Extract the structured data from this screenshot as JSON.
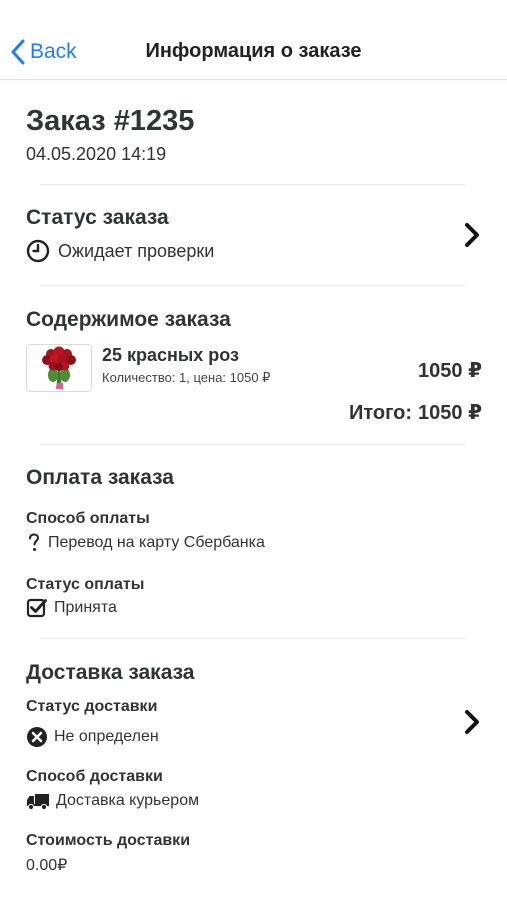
{
  "navbar": {
    "back_label": "Back",
    "title": "Информация о заказе"
  },
  "order": {
    "title": "Заказ #1235",
    "date": "04.05.2020 14:19"
  },
  "status_section": {
    "title": "Статус заказа",
    "status_icon": "clock-icon",
    "status_text": "Ожидает проверки"
  },
  "contents_section": {
    "title": "Содержимое заказа",
    "items": [
      {
        "name": "25 красных роз",
        "meta": "Количество: 1, цена: 1050 ₽",
        "price": "1050 ₽",
        "thumb_icon": "roses-bouquet-image"
      }
    ],
    "total_label": "Итого:",
    "total_value": "1050 ₽"
  },
  "payment_section": {
    "title": "Оплата заказа",
    "method_label": "Способ оплаты",
    "method_icon": "question-icon",
    "method_value": "Перевод на карту Сбербанка",
    "status_label": "Статус оплаты",
    "status_icon": "checkbox-checked-icon",
    "status_value": "Принята"
  },
  "delivery_section": {
    "title": "Доставка заказа",
    "status_label": "Статус доставки",
    "status_icon": "x-circle-icon",
    "status_value": "Не определен",
    "method_label": "Способ доставки",
    "method_icon": "truck-icon",
    "method_value": "Доставка курьером",
    "cost_label": "Стоимость доставки",
    "cost_value": "0.00₽"
  },
  "colors": {
    "accent": "#1f7ef7",
    "text": "#333333",
    "divider": "#e8e8e8"
  }
}
